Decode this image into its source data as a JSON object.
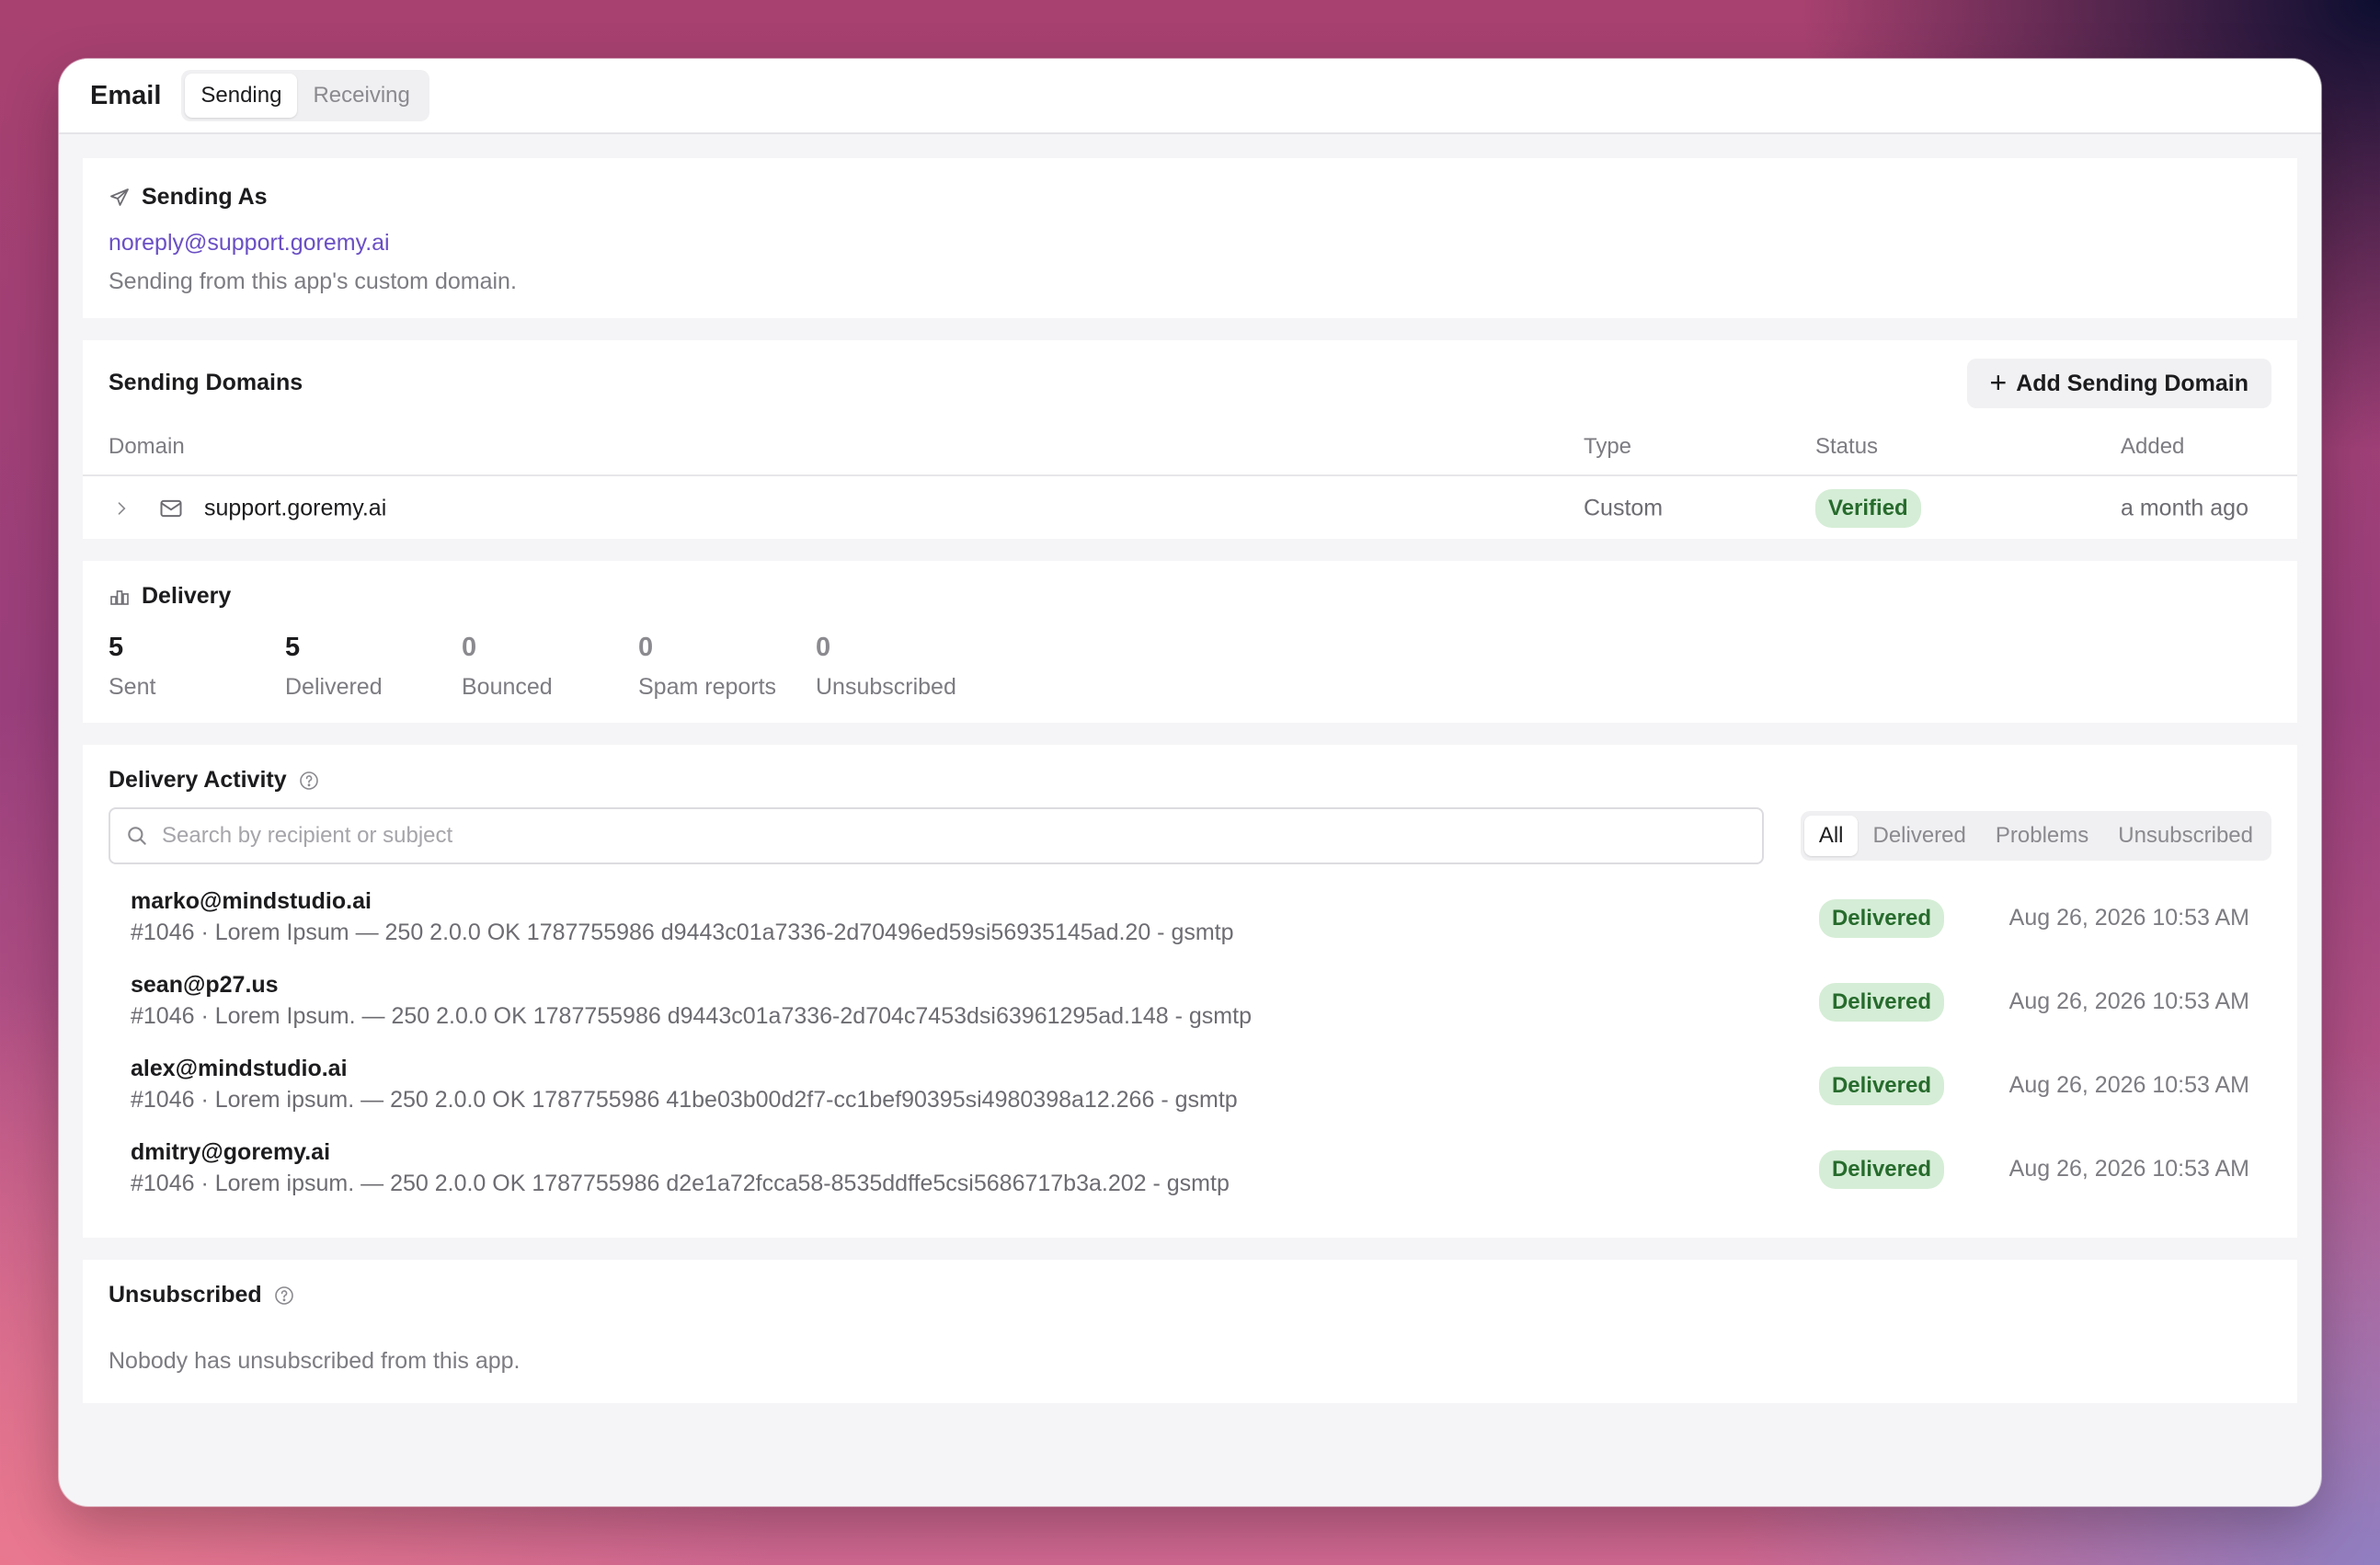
{
  "header": {
    "title": "Email",
    "tabs": [
      {
        "label": "Sending",
        "active": true
      },
      {
        "label": "Receiving",
        "active": false
      }
    ]
  },
  "sending_as": {
    "title": "Sending As",
    "icon": "send-icon",
    "email": "noreply@support.goremy.ai",
    "description": "Sending from this app's custom domain."
  },
  "sending_domains": {
    "title": "Sending Domains",
    "add_button": "Add Sending Domain",
    "columns": {
      "domain": "Domain",
      "type": "Type",
      "status": "Status",
      "added": "Added"
    },
    "rows": [
      {
        "domain": "support.goremy.ai",
        "type": "Custom",
        "status": "Verified",
        "added": "a month ago"
      }
    ]
  },
  "delivery": {
    "title": "Delivery",
    "icon": "bar-chart-icon",
    "stats": [
      {
        "value": "5",
        "label": "Sent"
      },
      {
        "value": "5",
        "label": "Delivered"
      },
      {
        "value": "0",
        "label": "Bounced"
      },
      {
        "value": "0",
        "label": "Spam reports"
      },
      {
        "value": "0",
        "label": "Unsubscribed"
      }
    ]
  },
  "delivery_activity": {
    "title": "Delivery Activity",
    "search_placeholder": "Search by recipient or subject",
    "filters": [
      {
        "label": "All",
        "active": true
      },
      {
        "label": "Delivered",
        "active": false
      },
      {
        "label": "Problems",
        "active": false
      },
      {
        "label": "Unsubscribed",
        "active": false
      }
    ],
    "rows": [
      {
        "to": "marko@mindstudio.ai",
        "meta": "#1046 · Lorem Ipsum — 250 2.0.0 OK 1787755986 d9443c01a7336-2d70496ed59si56935145ad.20 - gsmtp",
        "status": "Delivered",
        "time": "Aug 26, 2026 10:53 AM"
      },
      {
        "to": "sean@p27.us",
        "meta": "#1046 · Lorem Ipsum. — 250 2.0.0 OK 1787755986 d9443c01a7336-2d704c7453dsi63961295ad.148 - gsmtp",
        "status": "Delivered",
        "time": "Aug 26, 2026 10:53 AM"
      },
      {
        "to": "alex@mindstudio.ai",
        "meta": "#1046 · Lorem ipsum. — 250 2.0.0 OK 1787755986 41be03b00d2f7-cc1bef90395si4980398a12.266 - gsmtp",
        "status": "Delivered",
        "time": "Aug 26, 2026 10:53 AM"
      },
      {
        "to": "dmitry@goremy.ai",
        "meta": "#1046 · Lorem ipsum. — 250 2.0.0 OK 1787755986 d2e1a72fcca58-8535ddffe5csi5686717b3a.202 - gsmtp",
        "status": "Delivered",
        "time": "Aug 26, 2026 10:53 AM"
      }
    ]
  },
  "unsubscribed": {
    "title": "Unsubscribed",
    "empty_text": "Nobody has unsubscribed from this app."
  },
  "colors": {
    "accent_link": "#6a4fc4",
    "success_bg": "#d5edd6",
    "success_text": "#276b2d"
  }
}
